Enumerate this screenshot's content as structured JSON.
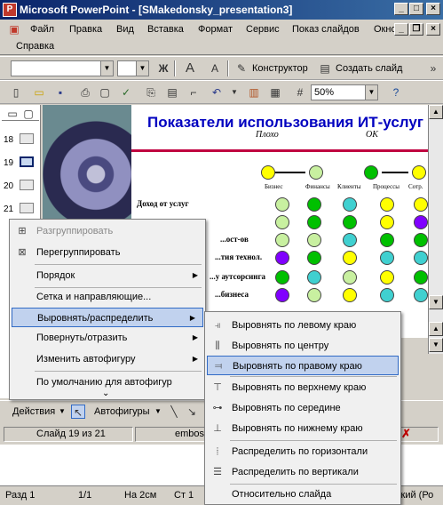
{
  "window": {
    "title": "Microsoft PowerPoint - [SMakedonsky_presentation3]"
  },
  "menu": {
    "items": [
      "Файл",
      "Правка",
      "Вид",
      "Вставка",
      "Формат",
      "Сервис",
      "Показ слайдов",
      "Окно"
    ],
    "help": "Справка"
  },
  "toolbar": {
    "designer": "Конструктор",
    "new_slide": "Создать слайд",
    "zoom": "50%"
  },
  "thumbnails": {
    "numbers": [
      "18",
      "19",
      "20",
      "21"
    ]
  },
  "slide": {
    "title": "Показатели использования ИТ-услуг",
    "legend_bad": "Плохо",
    "legend_ok": "OK",
    "rows": [
      "Доход от услуг",
      "...ост-ов",
      "...тия технол.",
      "...у аутсорсинга",
      "...бизнеса"
    ],
    "col_headers": [
      "Бизнес",
      "Финансы",
      "Клиенты",
      "Процессы",
      "Сотр."
    ]
  },
  "context_menu": {
    "items": [
      {
        "label": "Разгруппировать",
        "disabled": true,
        "icon": "ungroup-icon"
      },
      {
        "label": "Перегруппировать",
        "icon": "regroup-icon"
      },
      {
        "label": "Порядок",
        "submenu": true
      },
      {
        "label": "Сетка и направляющие..."
      },
      {
        "label": "Выровнять/распределить",
        "submenu": true,
        "highlighted": true
      },
      {
        "label": "Повернуть/отразить",
        "submenu": true
      },
      {
        "label": "Изменить автофигуру",
        "submenu": true
      },
      {
        "label": "По умолчанию для автофигур"
      }
    ],
    "more": "⌄"
  },
  "align_submenu": {
    "items": [
      {
        "label": "Выровнять по левому краю",
        "icon": "align-left-icon"
      },
      {
        "label": "Выровнять по центру",
        "icon": "align-center-icon"
      },
      {
        "label": "Выровнять по правому краю",
        "icon": "align-right-icon",
        "highlighted": true
      },
      {
        "label": "Выровнять по верхнему краю",
        "icon": "align-top-icon"
      },
      {
        "label": "Выровнять по середине",
        "icon": "align-middle-icon"
      },
      {
        "label": "Выровнять по нижнему краю",
        "icon": "align-bottom-icon"
      },
      {
        "label": "Распределить по горизонтали",
        "icon": "distribute-h-icon"
      },
      {
        "label": "Распределить по вертикали",
        "icon": "distribute-v-icon"
      },
      {
        "label": "Относительно слайда"
      }
    ]
  },
  "drawing_toolbar": {
    "actions": "Действия",
    "autoshapes": "Автофигуры"
  },
  "status": {
    "slide": "Слайд 19 из 21",
    "design": "emboss"
  },
  "bottom_status": {
    "section": "Разд 1",
    "page": "1/1",
    "at": "На 2см",
    "line": "Ст 1",
    "lang": "ский (Ро"
  }
}
